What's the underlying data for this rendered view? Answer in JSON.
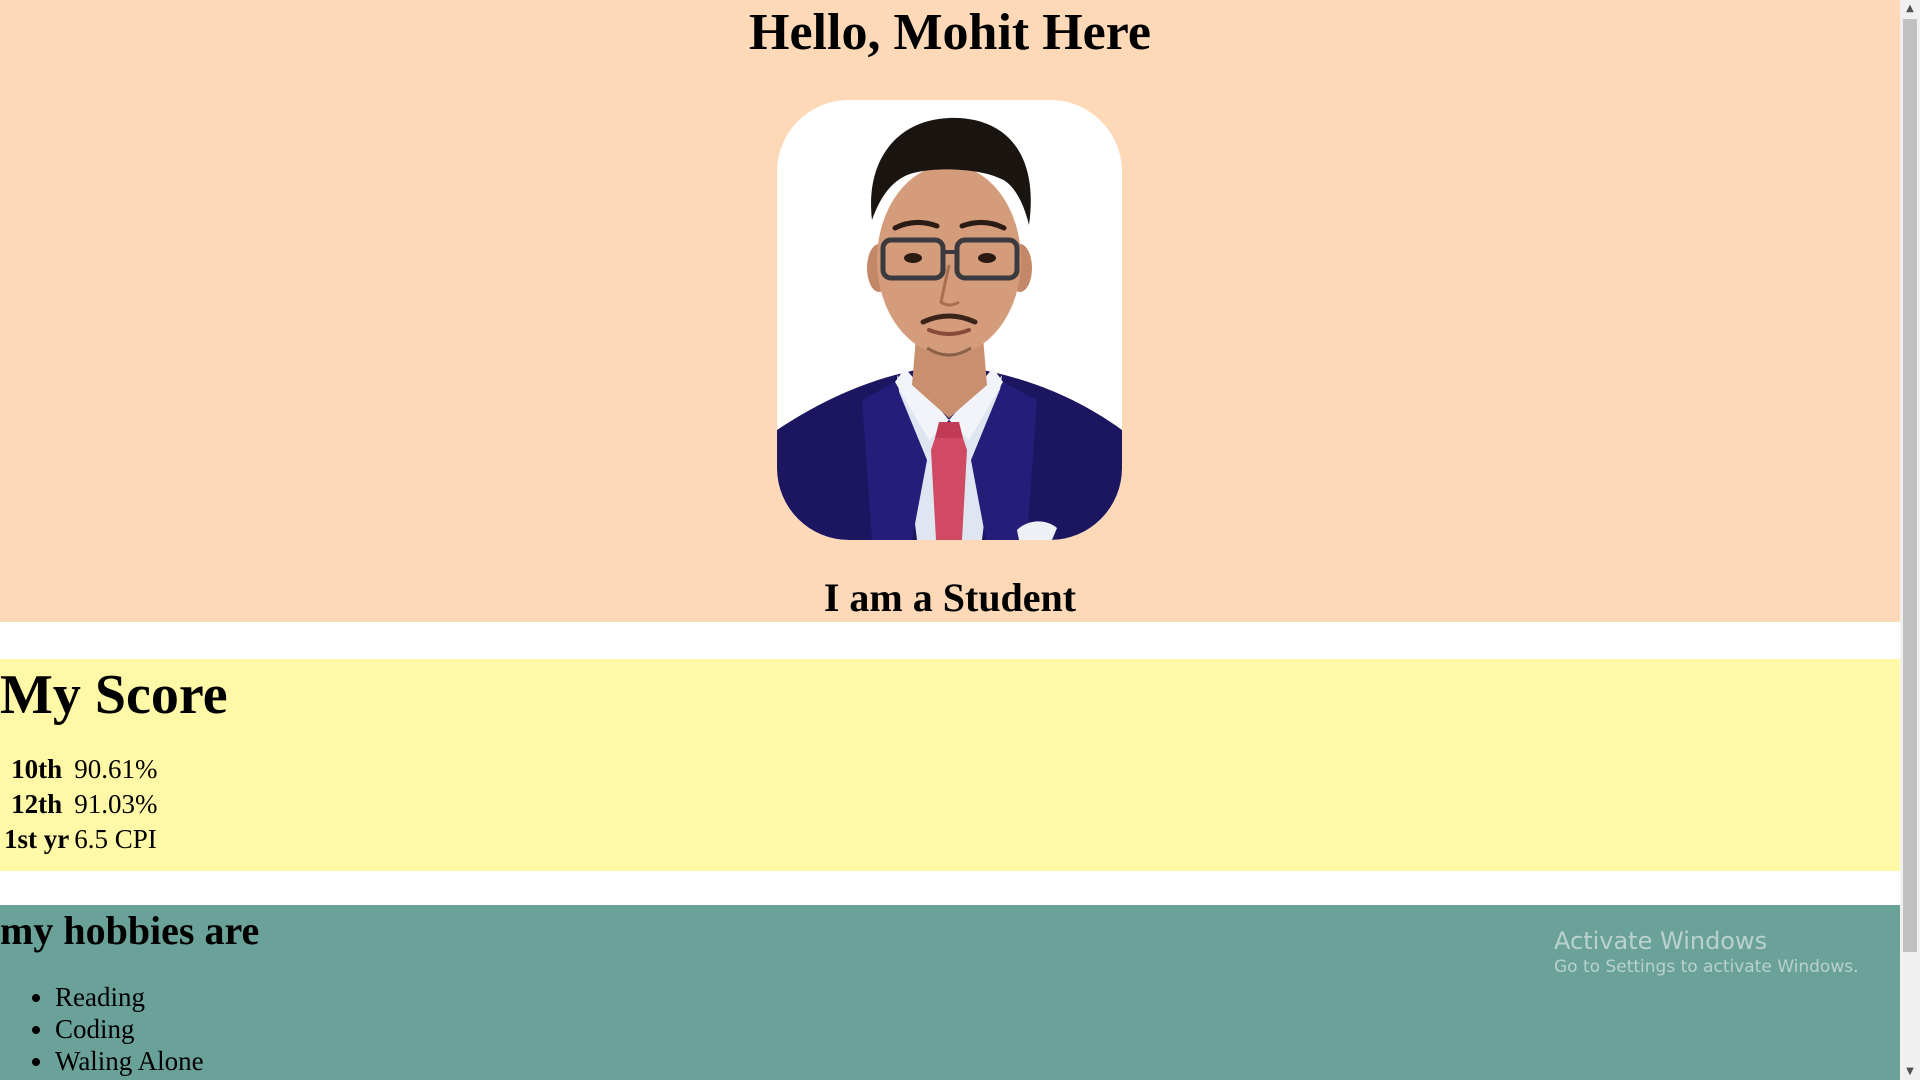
{
  "intro": {
    "greeting": "Hello, Mohit Here",
    "photo_alt": "Mohit",
    "tagline": "I am a Student"
  },
  "score": {
    "title": "My Score",
    "rows": [
      {
        "label": "10th",
        "value": "90.61%"
      },
      {
        "label": "12th",
        "value": "91.03%"
      },
      {
        "label": "1st yr",
        "value": "6.5 CPI"
      }
    ]
  },
  "hobbies": {
    "title": "my hobbies are",
    "items": [
      "Reading",
      "Coding",
      "Waling Alone"
    ]
  },
  "watermark": {
    "title": "Activate Windows",
    "subtitle": "Go to Settings to activate Windows."
  },
  "colors": {
    "intro_bg": "#fdd9b8",
    "score_bg": "#fff8a6",
    "hobbies_bg": "#6aa198"
  }
}
